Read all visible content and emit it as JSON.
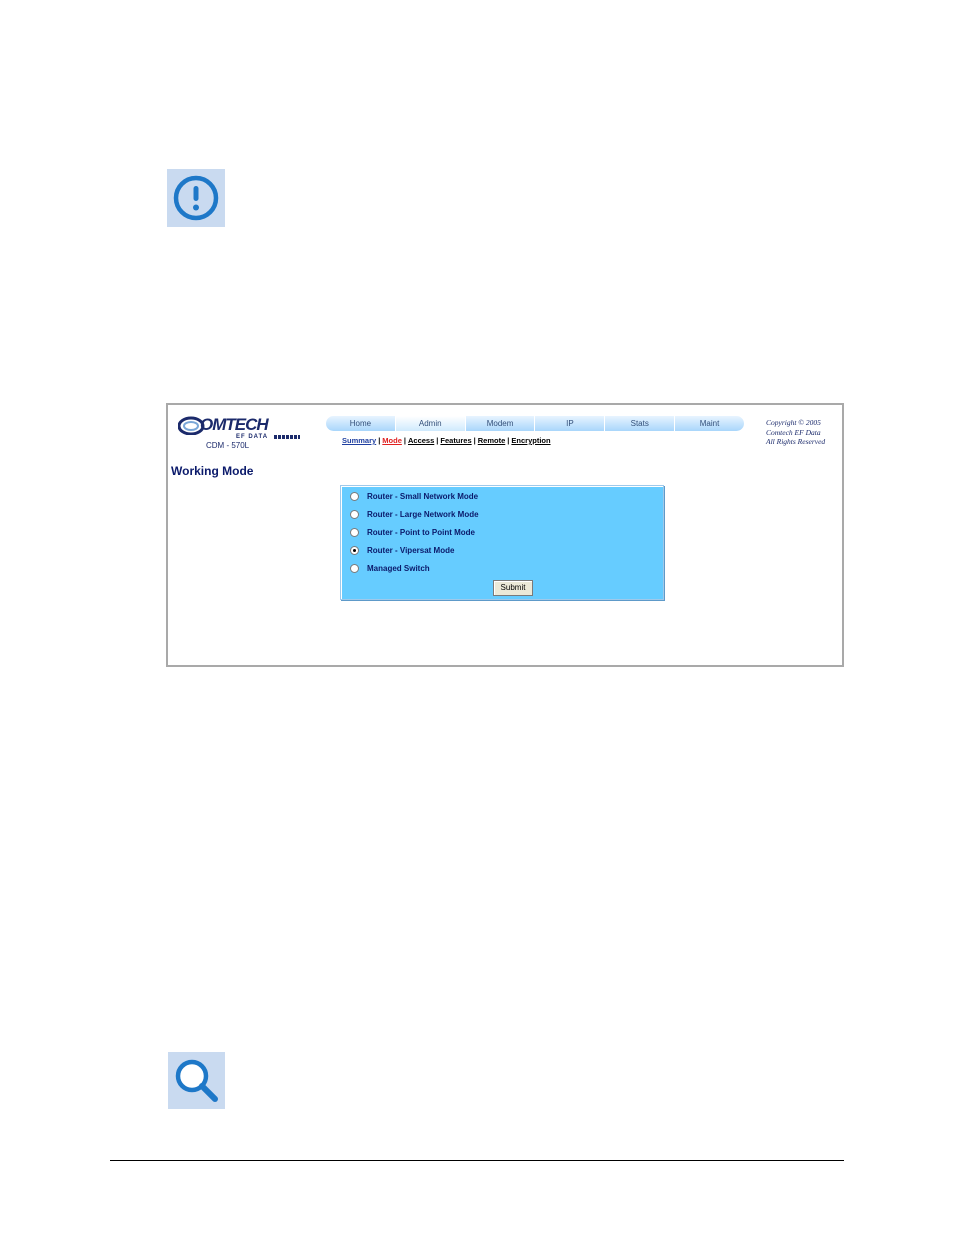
{
  "icons": {
    "notice": "exclamation-circle-icon",
    "reference": "magnifier-icon"
  },
  "logo": {
    "brand": "OMTECH",
    "sub": "EF DATA"
  },
  "model": "CDM - 570L",
  "tabs": [
    {
      "label": "Home"
    },
    {
      "label": "Admin"
    },
    {
      "label": "Modem"
    },
    {
      "label": "IP"
    },
    {
      "label": "Stats"
    },
    {
      "label": "Maint"
    }
  ],
  "subnav": [
    {
      "label": "Summary"
    },
    {
      "label": "Mode"
    },
    {
      "label": "Access"
    },
    {
      "label": "Features"
    },
    {
      "label": "Remote"
    },
    {
      "label": "Encryption"
    }
  ],
  "copyright": [
    "Copyright © 2005",
    "Comtech EF Data",
    "All Rights Reserved"
  ],
  "page_title": "Working Mode",
  "options": [
    {
      "label": "Router - Small Network Mode",
      "checked": false
    },
    {
      "label": "Router - Large Network Mode",
      "checked": false
    },
    {
      "label": "Router - Point to Point Mode",
      "checked": false
    },
    {
      "label": "Router - Vipersat Mode",
      "checked": true
    },
    {
      "label": "Managed Switch",
      "checked": false
    }
  ],
  "submit_label": "Submit",
  "colors": {
    "panel": "#66ccff",
    "title": "#0b1a6b",
    "active_subnav": "#e02020"
  }
}
